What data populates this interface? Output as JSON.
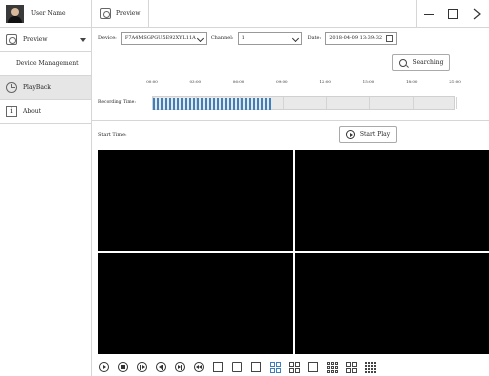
{
  "user": {
    "name": "User Name"
  },
  "sidebar": {
    "items": [
      {
        "label": "Preview",
        "icon": "camera-icon"
      },
      {
        "label": "Device Management",
        "icon": ""
      },
      {
        "label": "PlayBack",
        "icon": "clock-icon",
        "active": true
      },
      {
        "label": "About",
        "icon": "info-icon"
      }
    ]
  },
  "topbar": {
    "tab_label": "Preview"
  },
  "filters": {
    "device_label": "Device:",
    "device_value": "F7A4MSGPGU5E92XYL11A",
    "channel_label": "Channel:",
    "channel_value": "1",
    "date_label": "Date:",
    "date_value": "2018-04-09  13:39:32"
  },
  "search": {
    "label": "Searching"
  },
  "timeline": {
    "row_label": "Recording Time:",
    "ticks": [
      "00:00",
      "03:00",
      "06:00",
      "09:00",
      "12:00",
      "15:00",
      "18:00",
      "21:00"
    ],
    "recorded_until_hour": 8.1,
    "accent": "#3d7fbf"
  },
  "playback": {
    "start_time_label": "Start Time:",
    "start_button": "Start Play"
  },
  "toolbar": {
    "buttons": [
      "play-icon",
      "stop-icon",
      "step-forward-icon",
      "rewind-icon",
      "fast-forward-icon",
      "prev-icon",
      "snapshot-icon",
      "record-icon",
      "layout-1-icon",
      "layout-4-icon",
      "layout-6-icon",
      "layout-8-icon",
      "layout-9-icon",
      "layout-13-icon",
      "layout-16-icon"
    ]
  }
}
